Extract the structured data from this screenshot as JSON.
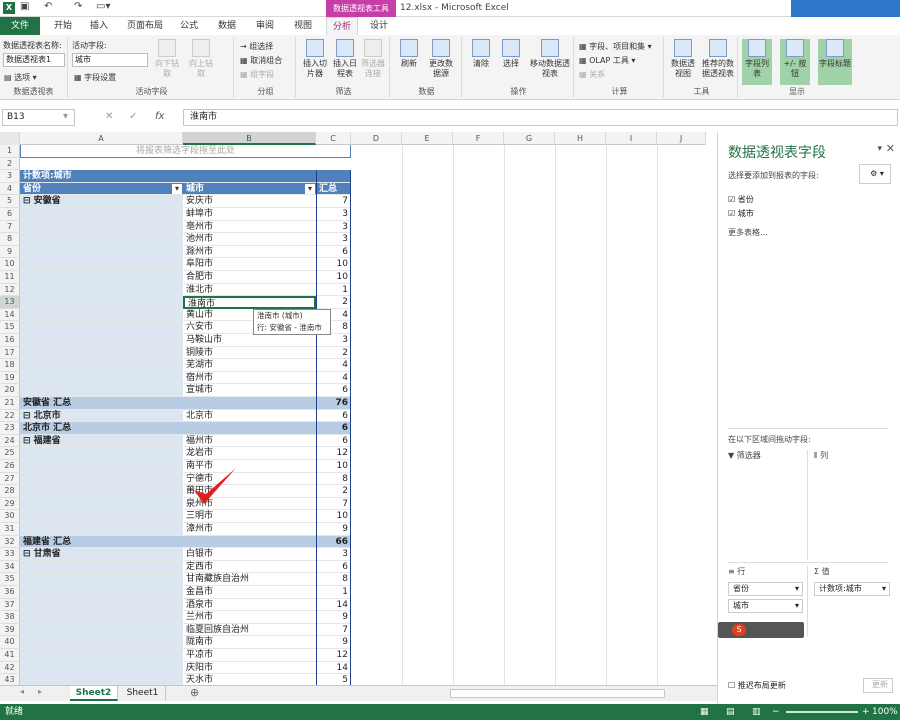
{
  "window": {
    "title": "12.xlsx - Microsoft Excel",
    "context_group": "数据透视表工具"
  },
  "tabs": [
    "文件",
    "开始",
    "插入",
    "页面布局",
    "公式",
    "数据",
    "审阅",
    "视图",
    "分析",
    "设计"
  ],
  "active_tab": "分析",
  "ribbon": {
    "pivot_name_label": "数据透视表名称:",
    "pivot_name_value": "数据透视表1",
    "options_label": "选项",
    "active_field_label": "活动字段:",
    "active_field_value": "城市",
    "field_settings_label": "字段设置",
    "drill_down": "向下钻取",
    "drill_up": "向上钻取",
    "group_selection": "组选择",
    "ungroup": "取消组合",
    "group_field": "组字段",
    "insert_slicer": "插入切片器",
    "insert_timeline": "插入日程表",
    "filter_connections": "筛选器连接",
    "refresh": "刷新",
    "change_source": "更改数据源",
    "clear": "清除",
    "select": "选择",
    "move_pivot": "移动数据透视表",
    "fields_items": "字段、项目和集",
    "olap_tools": "OLAP 工具",
    "relationships": "关系",
    "pivot_chart": "数据透视图",
    "recommended": "推荐的数据透视表",
    "field_list": "字段列表",
    "plus_minus": "+/- 按钮",
    "field_headers": "字段标题",
    "groups": {
      "pivot": "数据透视表",
      "active_field": "活动字段",
      "group": "分组",
      "filter": "筛选",
      "data": "数据",
      "actions": "操作",
      "calc": "计算",
      "tools": "工具",
      "show": "显示"
    }
  },
  "formula_bar": {
    "name_box": "B13",
    "content": "淮南市"
  },
  "columns": [
    "A",
    "B",
    "C",
    "D",
    "E",
    "F",
    "G",
    "H",
    "I",
    "J"
  ],
  "grid": {
    "placeholder": "将报表筛选字段拖至此处",
    "count_label": "计数项:城市",
    "header_province": "省份",
    "header_city": "城市",
    "header_total": "汇总",
    "tooltip_line1": "淮南市 (城市)",
    "tooltip_line2": "行: 安徽省 - 淮南市",
    "rows": [
      {
        "n": "1",
        "a": "",
        "b": "",
        "c": "",
        "t": "ph"
      },
      {
        "n": "2",
        "a": "",
        "b": "",
        "c": "",
        "t": ""
      },
      {
        "n": "3",
        "a": "计数项:城市",
        "b": "",
        "c": "",
        "t": "hdr1"
      },
      {
        "n": "4",
        "a": "省份",
        "b": "城市",
        "c": "汇总",
        "t": "hdr2"
      },
      {
        "n": "5",
        "a": "⊟ 安徽省",
        "b": "安庆市",
        "c": "7",
        "t": "prov"
      },
      {
        "n": "6",
        "a": "",
        "b": "蚌埠市",
        "c": "3",
        "t": "item"
      },
      {
        "n": "7",
        "a": "",
        "b": "亳州市",
        "c": "3",
        "t": "item"
      },
      {
        "n": "8",
        "a": "",
        "b": "池州市",
        "c": "3",
        "t": "item"
      },
      {
        "n": "9",
        "a": "",
        "b": "滁州市",
        "c": "6",
        "t": "item"
      },
      {
        "n": "10",
        "a": "",
        "b": "阜阳市",
        "c": "10",
        "t": "item"
      },
      {
        "n": "11",
        "a": "",
        "b": "合肥市",
        "c": "10",
        "t": "item"
      },
      {
        "n": "12",
        "a": "",
        "b": "淮北市",
        "c": "1",
        "t": "item"
      },
      {
        "n": "13",
        "a": "",
        "b": "淮南市",
        "c": "2",
        "t": "item"
      },
      {
        "n": "14",
        "a": "",
        "b": "黄山市",
        "c": "4",
        "t": "item"
      },
      {
        "n": "15",
        "a": "",
        "b": "六安市",
        "c": "8",
        "t": "item"
      },
      {
        "n": "16",
        "a": "",
        "b": "马鞍山市",
        "c": "3",
        "t": "item"
      },
      {
        "n": "17",
        "a": "",
        "b": "铜陵市",
        "c": "2",
        "t": "item"
      },
      {
        "n": "18",
        "a": "",
        "b": "芜湖市",
        "c": "4",
        "t": "item"
      },
      {
        "n": "19",
        "a": "",
        "b": "宿州市",
        "c": "4",
        "t": "item"
      },
      {
        "n": "20",
        "a": "",
        "b": "宣城市",
        "c": "6",
        "t": "item"
      },
      {
        "n": "21",
        "a": "安徽省 汇总",
        "b": "",
        "c": "76",
        "t": "sub"
      },
      {
        "n": "22",
        "a": "⊟ 北京市",
        "b": "北京市",
        "c": "6",
        "t": "prov"
      },
      {
        "n": "23",
        "a": "北京市 汇总",
        "b": "",
        "c": "6",
        "t": "sub"
      },
      {
        "n": "24",
        "a": "⊟ 福建省",
        "b": "福州市",
        "c": "6",
        "t": "prov"
      },
      {
        "n": "25",
        "a": "",
        "b": "龙岩市",
        "c": "12",
        "t": "item"
      },
      {
        "n": "26",
        "a": "",
        "b": "南平市",
        "c": "10",
        "t": "item"
      },
      {
        "n": "27",
        "a": "",
        "b": "宁德市",
        "c": "8",
        "t": "item"
      },
      {
        "n": "28",
        "a": "",
        "b": "莆田市",
        "c": "2",
        "t": "item"
      },
      {
        "n": "29",
        "a": "",
        "b": "泉州市",
        "c": "7",
        "t": "item"
      },
      {
        "n": "30",
        "a": "",
        "b": "三明市",
        "c": "10",
        "t": "item"
      },
      {
        "n": "31",
        "a": "",
        "b": "漳州市",
        "c": "9",
        "t": "item"
      },
      {
        "n": "32",
        "a": "福建省 汇总",
        "b": "",
        "c": "66",
        "t": "sub"
      },
      {
        "n": "33",
        "a": "⊟ 甘肃省",
        "b": "白银市",
        "c": "3",
        "t": "prov"
      },
      {
        "n": "34",
        "a": "",
        "b": "定西市",
        "c": "6",
        "t": "item"
      },
      {
        "n": "35",
        "a": "",
        "b": "甘南藏族自治州",
        "c": "8",
        "t": "item"
      },
      {
        "n": "36",
        "a": "",
        "b": "金昌市",
        "c": "1",
        "t": "item"
      },
      {
        "n": "37",
        "a": "",
        "b": "酒泉市",
        "c": "14",
        "t": "item"
      },
      {
        "n": "38",
        "a": "",
        "b": "兰州市",
        "c": "9",
        "t": "item"
      },
      {
        "n": "39",
        "a": "",
        "b": "临夏回族自治州",
        "c": "7",
        "t": "item"
      },
      {
        "n": "40",
        "a": "",
        "b": "陇南市",
        "c": "9",
        "t": "item"
      },
      {
        "n": "41",
        "a": "",
        "b": "平凉市",
        "c": "12",
        "t": "item"
      },
      {
        "n": "42",
        "a": "",
        "b": "庆阳市",
        "c": "14",
        "t": "item"
      },
      {
        "n": "43",
        "a": "",
        "b": "天水市",
        "c": "5",
        "t": "item"
      }
    ]
  },
  "pane": {
    "title": "数据透视表字段",
    "choose_label": "选择要添加到报表的字段:",
    "fields": [
      "省份",
      "城市"
    ],
    "more_tables": "更多表格...",
    "drag_label": "在以下区域间拖动字段:",
    "filters": "筛选器",
    "columns": "列",
    "rows": "行",
    "values": "值",
    "row_fields": [
      "省份",
      "城市"
    ],
    "value_field": "计数项:城市",
    "defer_update": "推迟布局更新",
    "update": "更新"
  },
  "sheets": [
    "Sheet2",
    "Sheet1"
  ],
  "active_sheet": "Sheet2",
  "status": {
    "ready": "就绪",
    "zoom": "100%"
  },
  "colors": {
    "excel_green": "#217346",
    "context_pink": "#c63fa7",
    "pivot_header": "#4f81bd",
    "pivot_band": "#dce6f1",
    "pivot_subtotal": "#b8cce4",
    "checkmark_red": "#e0201c"
  }
}
